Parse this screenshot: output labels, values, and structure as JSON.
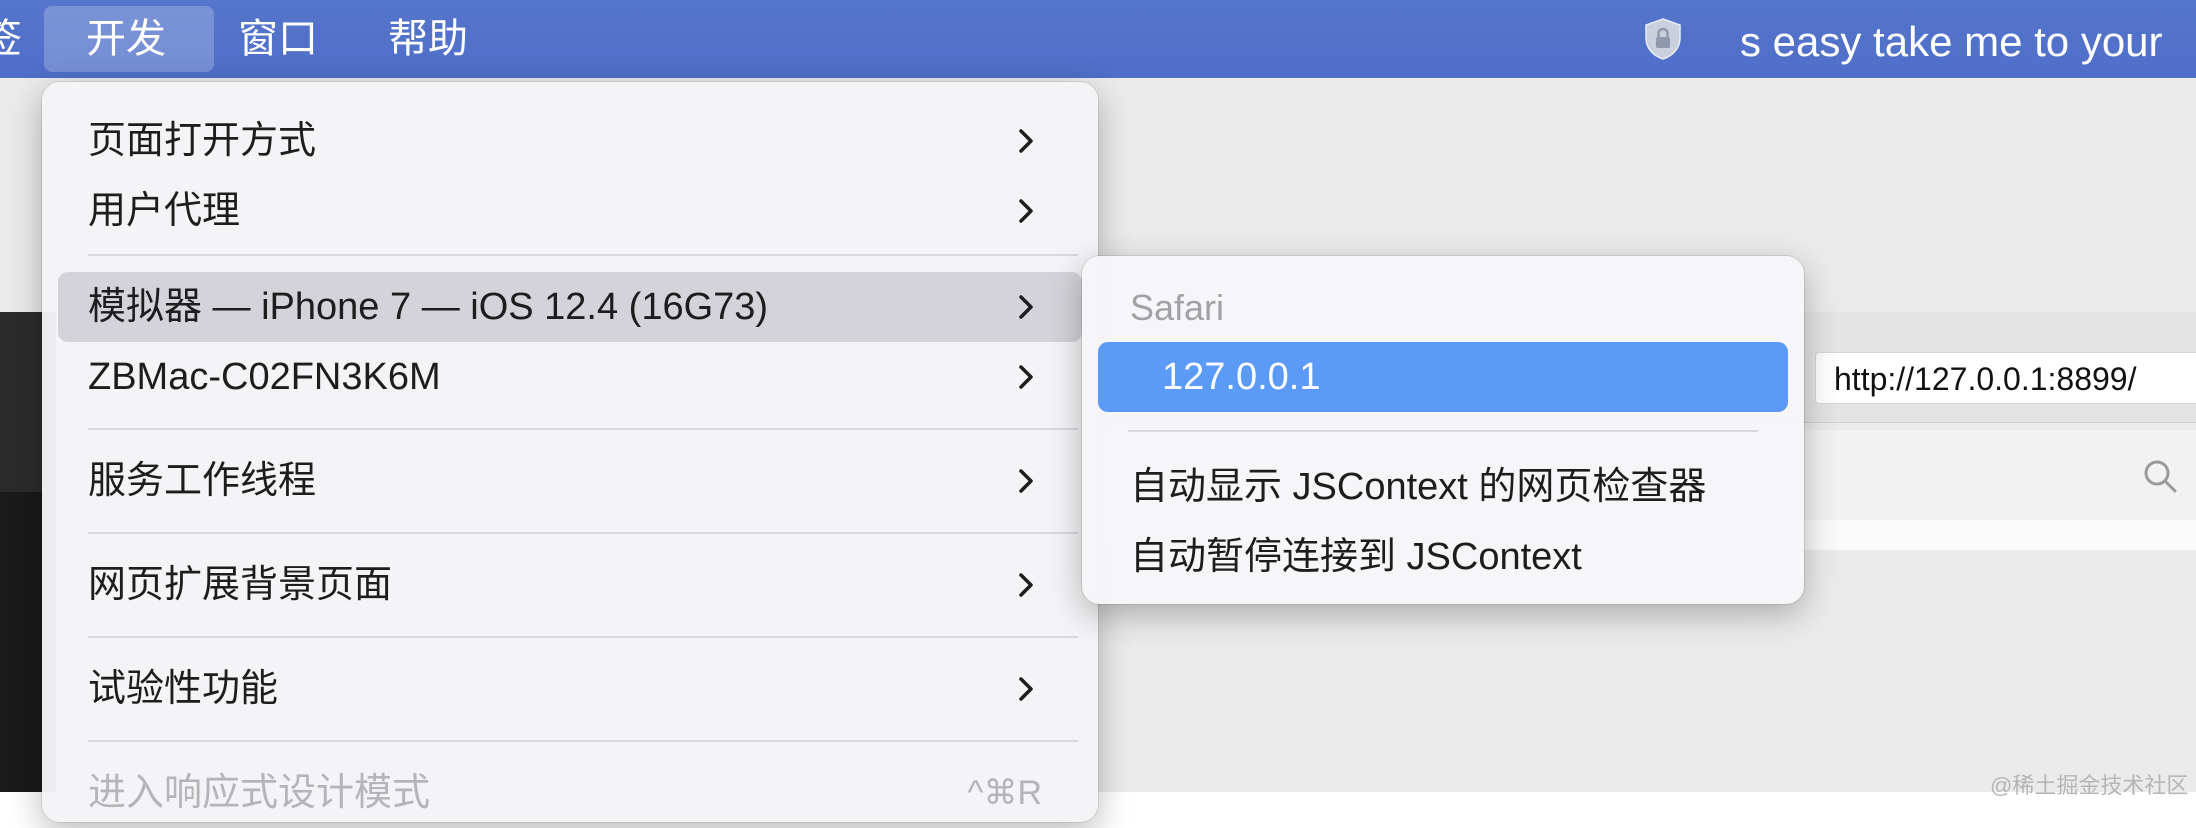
{
  "menubar": {
    "cut_item": "签",
    "develop": "开发",
    "window": "窗口",
    "help": "帮助",
    "marquee": "s easy take me to your"
  },
  "browser": {
    "url": "http://127.0.0.1:8899/"
  },
  "develop_menu": {
    "items": [
      {
        "label": "页面打开方式",
        "has_submenu": true
      },
      {
        "label": "用户代理",
        "has_submenu": true
      },
      {
        "label": "模拟器 — iPhone 7 — iOS 12.4 (16G73)",
        "has_submenu": true,
        "highlighted": true
      },
      {
        "label": "ZBMac-C02FN3K6M",
        "has_submenu": true
      },
      {
        "label": "服务工作线程",
        "has_submenu": true
      },
      {
        "label": "网页扩展背景页面",
        "has_submenu": true
      },
      {
        "label": "试验性功能",
        "has_submenu": true
      },
      {
        "label": "进入响应式设计模式",
        "shortcut": "^⌘R",
        "disabled": true
      }
    ]
  },
  "submenu": {
    "header": "Safari",
    "selected": "127.0.0.1",
    "items": [
      "自动显示 JSContext 的网页检查器",
      "自动暂停连接到 JSContext"
    ]
  },
  "watermark": "@稀土掘金技术社区",
  "colors": {
    "menubar": "#5173c9",
    "selection": "#5b9bf7",
    "highlight": "#d3d3d9"
  }
}
